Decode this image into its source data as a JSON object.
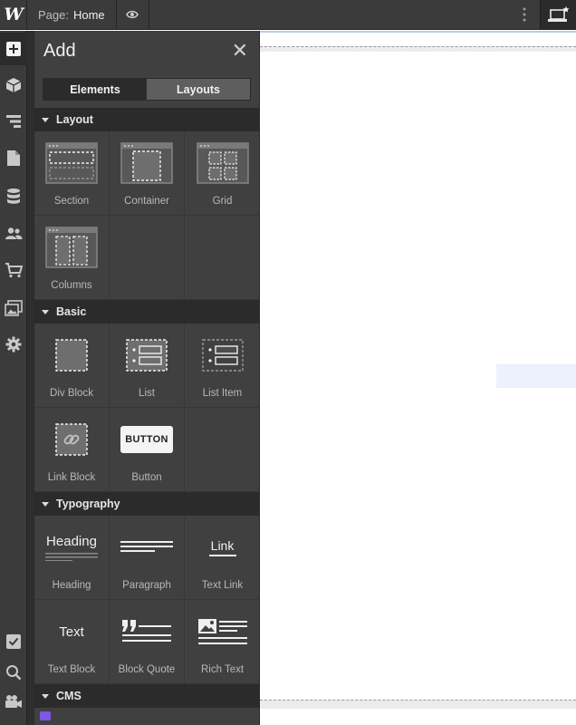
{
  "topbar": {
    "logo": "W",
    "page_label": "Page:",
    "page_name": "Home",
    "icons": [
      "eye-icon",
      "kebab-menu-icon",
      "laptop-star-icon"
    ]
  },
  "rail": {
    "top_icons": [
      "add-icon",
      "box-icon",
      "navigator-icon",
      "pages-icon",
      "cms-database-icon",
      "users-icon",
      "ecommerce-cart-icon",
      "assets-image-icon",
      "settings-gear-icon"
    ],
    "bottom_icons": [
      "checkbox-icon",
      "search-icon",
      "video-icon"
    ]
  },
  "panel": {
    "title": "Add",
    "tabs": {
      "elements": "Elements",
      "layouts": "Layouts"
    },
    "sections": {
      "layout": {
        "title": "Layout",
        "items": [
          {
            "label": "Section"
          },
          {
            "label": "Container"
          },
          {
            "label": "Grid"
          },
          {
            "label": "Columns"
          }
        ]
      },
      "basic": {
        "title": "Basic",
        "items": [
          {
            "label": "Div Block"
          },
          {
            "label": "List"
          },
          {
            "label": "List Item"
          },
          {
            "label": "Link Block"
          },
          {
            "label": "Button",
            "icon_text": "BUTTON"
          }
        ]
      },
      "typography": {
        "title": "Typography",
        "items": [
          {
            "label": "Heading",
            "icon_text": "Heading"
          },
          {
            "label": "Paragraph"
          },
          {
            "label": "Text Link",
            "icon_text": "Link"
          },
          {
            "label": "Text Block",
            "icon_text": "Text"
          },
          {
            "label": "Block Quote"
          },
          {
            "label": "Rich Text"
          }
        ]
      },
      "cms": {
        "title": "CMS"
      }
    }
  },
  "colors": {
    "chrome": "#3b3b3b",
    "panel": "#404040",
    "section_header": "#2b2b2b",
    "accent_purple": "#7e57e6"
  }
}
